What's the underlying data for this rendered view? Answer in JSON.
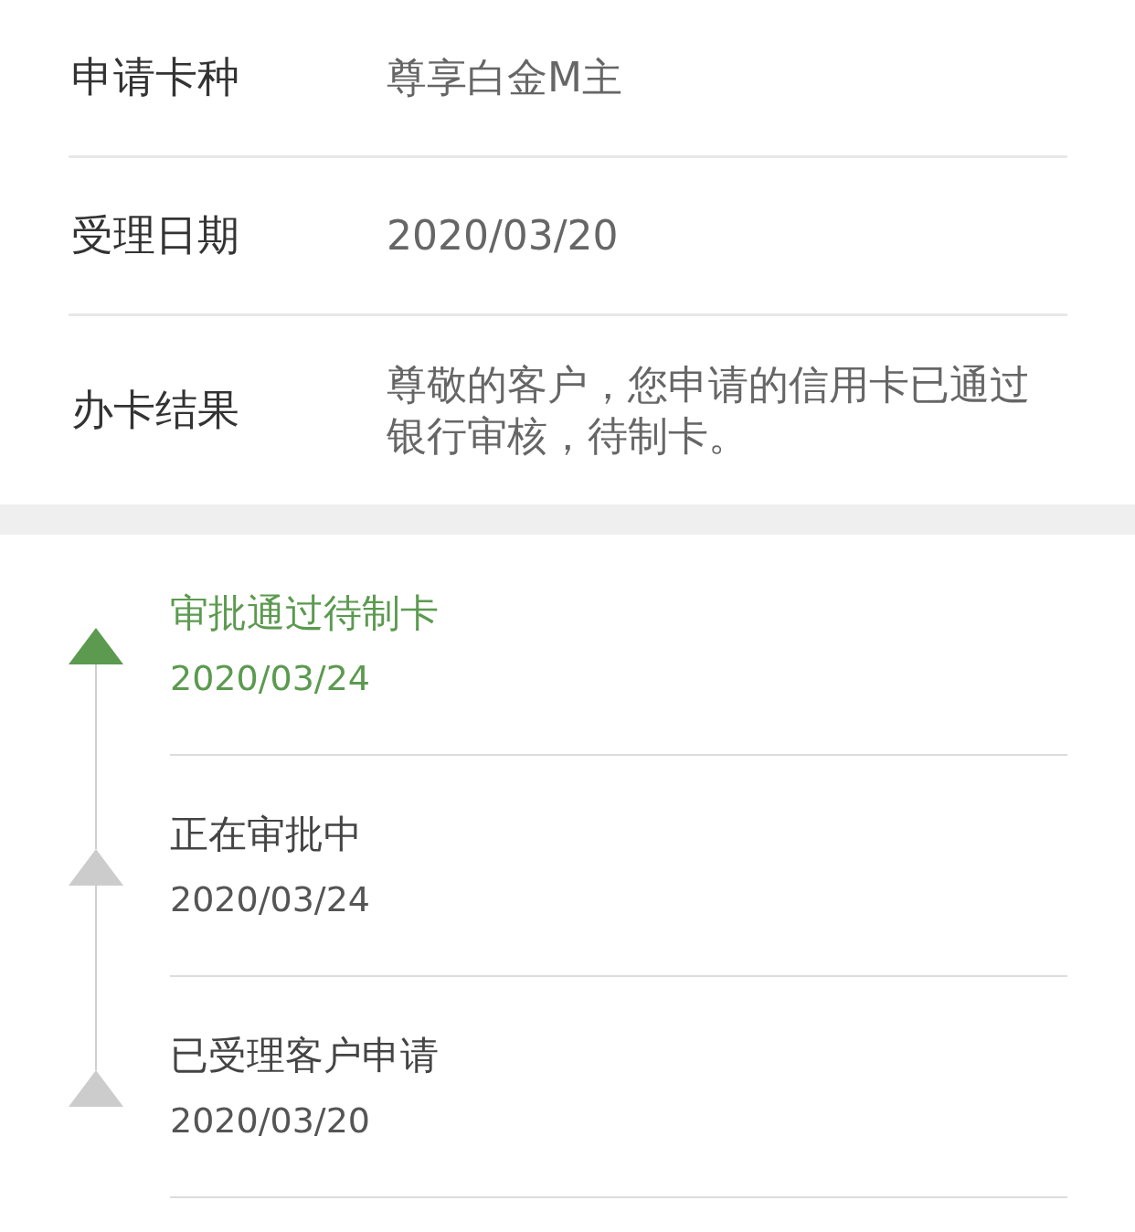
{
  "details": [
    {
      "label": "申请卡种",
      "value": "尊享白金M主"
    },
    {
      "label": "受理日期",
      "value": "2020/03/20"
    },
    {
      "label": "办卡结果",
      "value": "尊敬的客户，您申请的信用卡已通过银行审核，待制卡。"
    }
  ],
  "timeline": [
    {
      "title": "审批通过待制卡",
      "date": "2020/03/24",
      "active": true
    },
    {
      "title": "正在审批中",
      "date": "2020/03/24",
      "active": false
    },
    {
      "title": "已受理客户申请",
      "date": "2020/03/20",
      "active": false
    }
  ]
}
